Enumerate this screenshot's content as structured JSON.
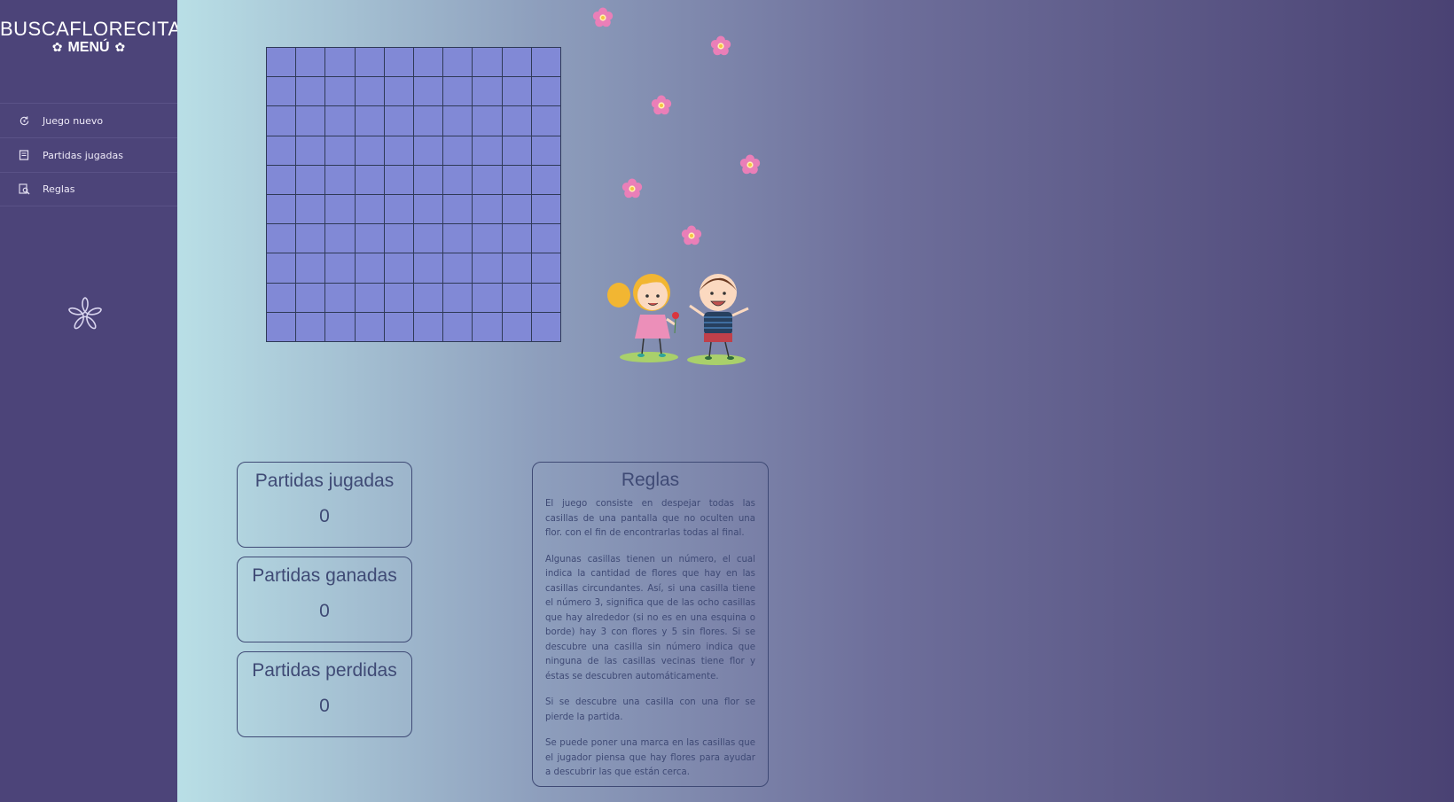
{
  "sidebar": {
    "brand": "BUSCAFLORECITAS",
    "menu_label": "MENÚ",
    "items": [
      {
        "label": "Juego nuevo",
        "icon": "refresh-icon"
      },
      {
        "label": "Partidas jugadas",
        "icon": "book-icon"
      },
      {
        "label": "Reglas",
        "icon": "search-document-icon"
      }
    ],
    "logo_icon": "flower-outline-icon"
  },
  "board": {
    "rows": 10,
    "cols": 10,
    "cell_color": "#8189d6"
  },
  "stats": [
    {
      "title": "Partidas jugadas",
      "value": "0"
    },
    {
      "title": "Partidas ganadas",
      "value": "0"
    },
    {
      "title": "Partidas perdidas",
      "value": "0"
    }
  ],
  "rules": {
    "title": "Reglas",
    "paragraphs": [
      "El juego consiste en despejar todas las casillas de una pantalla que no oculten una flor. con el fin de encontrarlas todas al final.",
      "Algunas casillas tienen un número, el cual indica la cantidad de flores que hay en las casillas circundantes. Así, si una casilla tiene el número 3, significa que de las ocho casillas que hay alrededor (si no es en una esquina o borde) hay 3 con flores y 5 sin flores. Si se descubre una casilla sin número indica que ninguna de las casillas vecinas tiene flor y éstas se descubren automáticamente.",
      "Si se descubre una casilla con una flor se pierde la partida.",
      "Se puede poner una marca en las casillas que el jugador piensa que hay flores para ayudar a descubrir las que están cerca."
    ]
  },
  "colors": {
    "sidebar_bg": "#4c4479",
    "text_dark": "#3f4a75",
    "petal_pink": "#ea7fb8"
  }
}
